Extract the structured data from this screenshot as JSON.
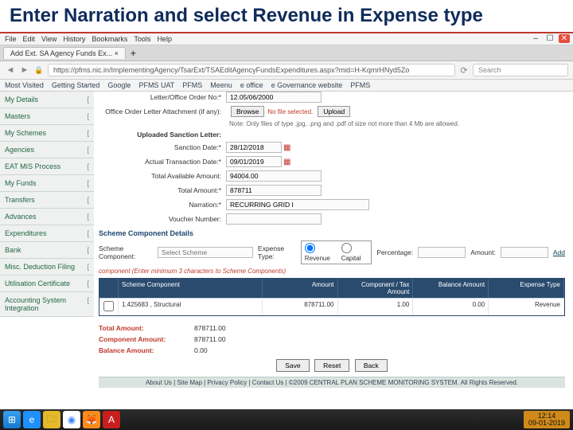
{
  "slide_title": "Enter Narration and select Revenue in Expense type",
  "browser": {
    "menu": [
      "File",
      "Edit",
      "View",
      "History",
      "Bookmarks",
      "Tools",
      "Help"
    ],
    "tab_title": "Add Ext. SA Agency Funds Ex... ×",
    "url": "https://pfms.nic.in/ImplementingAgency/TsarExt/TSAEditAgencyFundsExpenditures.aspx?mid=H-KqmrHNyd5Zo",
    "search_placeholder": "Search",
    "bookmarks": [
      "Most Visited",
      "Getting Started",
      "Google",
      "PFMS UAT",
      "PFMS",
      "Meenu",
      "e office",
      "e Governance website",
      "PFMS"
    ]
  },
  "sidebar": [
    "My Details",
    "Masters",
    "My Schemes",
    "Agencies",
    "EAT MIS Process",
    "My Funds",
    "Transfers",
    "Advances",
    "Expenditures",
    "Bank",
    "Misc. Deduction Filing",
    "Utilisation Certificate",
    "Accounting System Integration"
  ],
  "form": {
    "letter_no_label": "Letter/Office Order No:*",
    "letter_no_value": "12.05/06/2000",
    "attach_label": "Office Order Letter Attachment (if any):",
    "attach_note": "No file selected.",
    "attach_btn": "Browse",
    "upload_btn": "Upload",
    "upload_hint": "Note: Only files of type .jpg, .png and .pdf of size not more than 4 Mb are allowed.",
    "uploaded_label": "Uploaded Sanction Letter:",
    "sanction_date_label": "Sanction Date:*",
    "sanction_date_value": "28/12/2018",
    "txn_date_label": "Actual Transaction Date:*",
    "txn_date_value": "09/01/2019",
    "total_avail_label": "Total Available Amount:",
    "total_avail_value": "94004.00",
    "total_amount_label": "Total Amount:*",
    "total_amount_value": "878711",
    "narration_label": "Narration:*",
    "narration_value": "RECURRING GRID I",
    "voucher_label": "Voucher Number:"
  },
  "components": {
    "section": "Scheme Component Details",
    "comp_label": "Scheme Component:",
    "comp_placeholder": "Select Scheme",
    "comp_min_note": "component\n(Enter minimum 3 characters to Scheme Components)",
    "expense_type_label": "Expense Type:",
    "expense_revenue": "Revenue",
    "expense_capital": "Capital",
    "percentage_label": "Percentage:",
    "amount_label": "Amount:",
    "add_link": "Add"
  },
  "grid": {
    "headers": [
      "",
      "Scheme Component",
      "Amount",
      "Component / Tax Amount",
      "Balance Amount",
      "Expense Type"
    ],
    "row": {
      "scheme": "1.425683 , Structural",
      "amount": "878711.00",
      "tax": "1.00",
      "balance": "0.00",
      "type": "Revenue"
    }
  },
  "totals": {
    "total_amount_label": "Total Amount:",
    "total_amount_value": "878711.00",
    "component_label": "Component Amount:",
    "component_value": "878711.00",
    "balance_label": "Balance Amount:",
    "balance_value": "0.00"
  },
  "buttons": {
    "save": "Save",
    "reset": "Reset",
    "back": "Back"
  },
  "footer": "About Us | Site Map | Privacy Policy | Contact Us | ©2009 CENTRAL PLAN SCHEME MONITORING SYSTEM. All Rights Reserved.",
  "taskbar": {
    "time": "12:14",
    "date": "09-01-2019"
  }
}
